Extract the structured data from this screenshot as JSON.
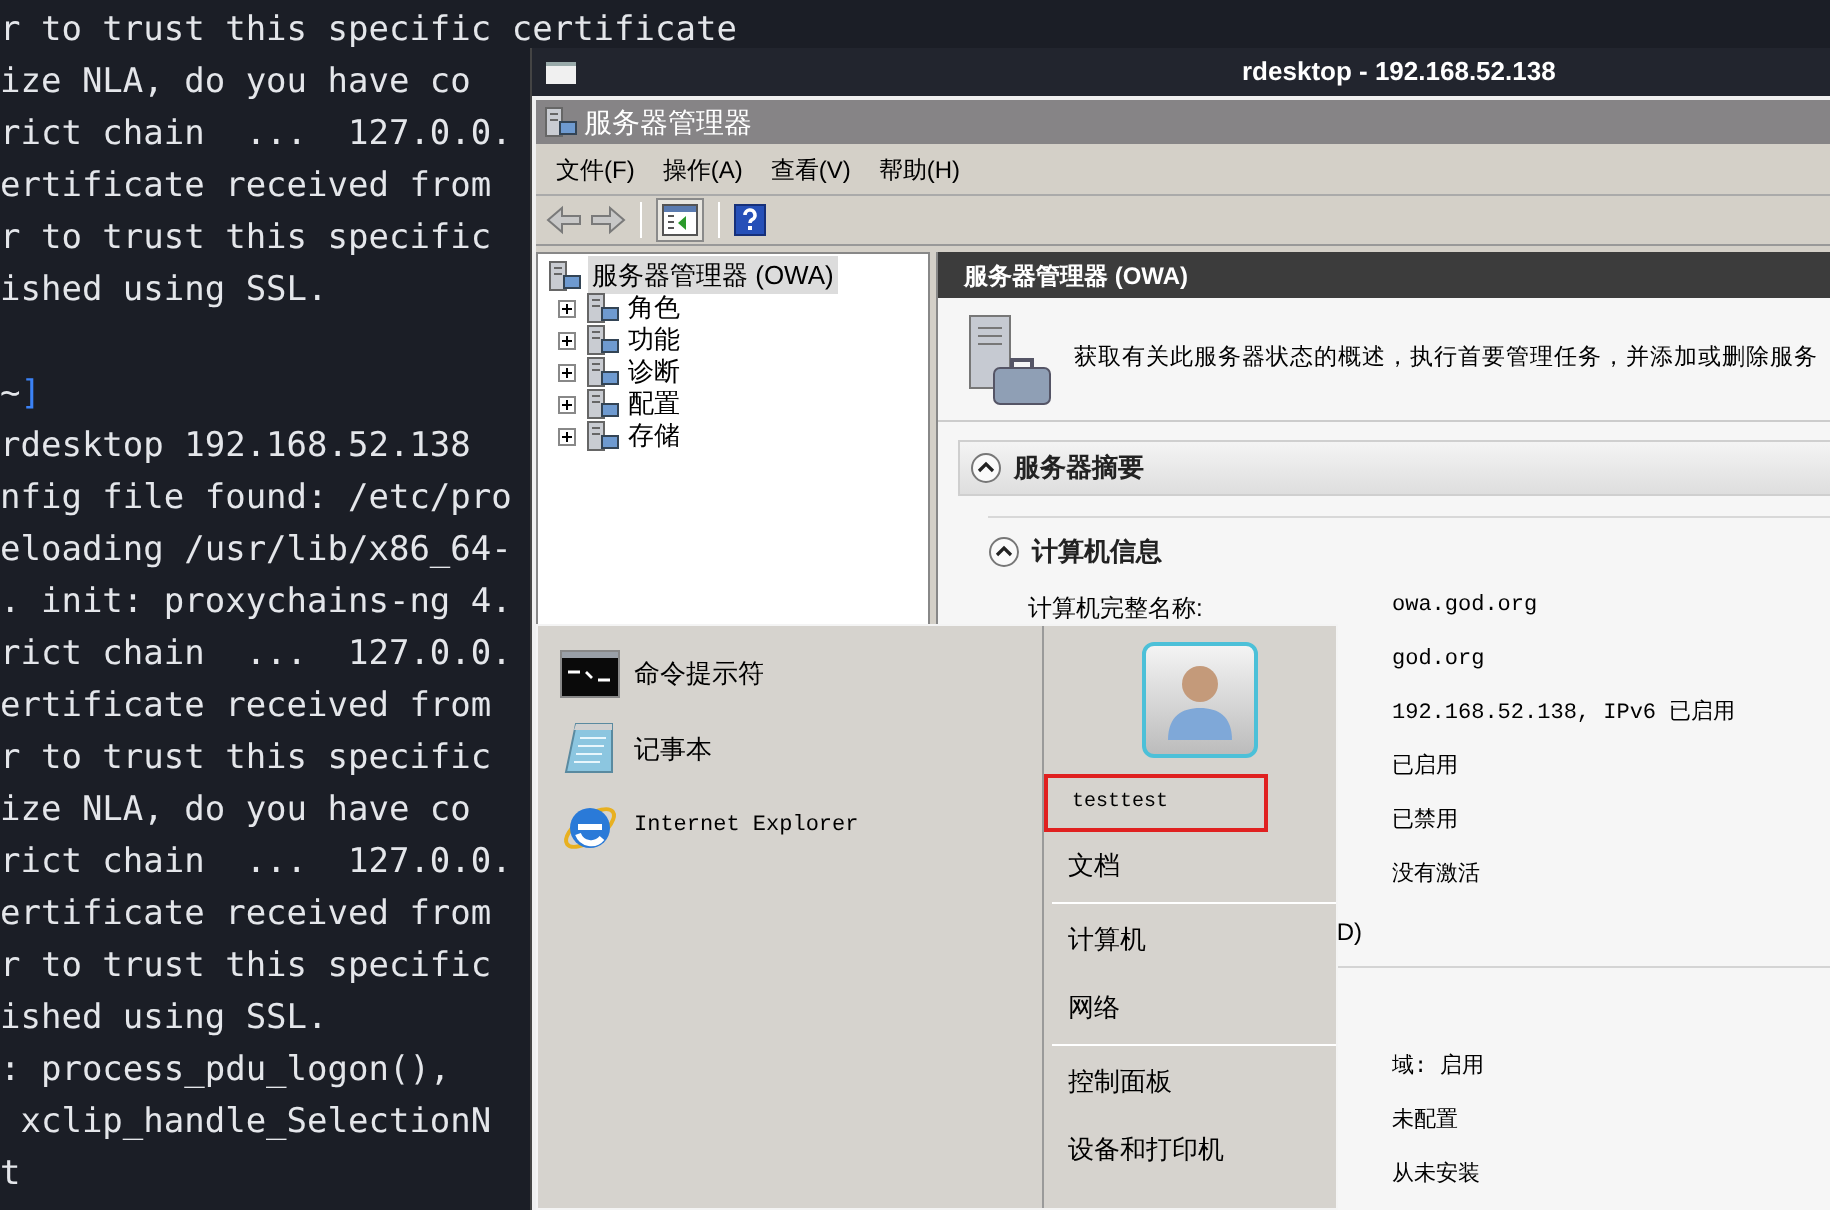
{
  "terminal": {
    "lines": [
      {
        "kind": "output",
        "text": "r to trust this specific certificate"
      },
      {
        "kind": "output",
        "text": "ize NLA, do you have co"
      },
      {
        "kind": "output",
        "text": "rict chain  ...  127.0.0."
      },
      {
        "kind": "output",
        "text": "ertificate received from"
      },
      {
        "kind": "output",
        "text": "r to trust this specific"
      },
      {
        "kind": "output",
        "text": "ished using SSL."
      },
      {
        "kind": "prompt",
        "dir": "~",
        "bracket": "]",
        "blank_before": true
      },
      {
        "kind": "output",
        "text": "rdesktop 192.168.52.138"
      },
      {
        "kind": "output",
        "text": "nfig file found: /etc/pro"
      },
      {
        "kind": "output",
        "text": "eloading /usr/lib/x86_64-"
      },
      {
        "kind": "output",
        "text": ". init: proxychains-ng 4."
      },
      {
        "kind": "output",
        "text": "rict chain  ...  127.0.0."
      },
      {
        "kind": "output",
        "text": "ertificate received from"
      },
      {
        "kind": "output",
        "text": "r to trust this specific"
      },
      {
        "kind": "output",
        "text": "ize NLA, do you have co"
      },
      {
        "kind": "output",
        "text": "rict chain  ...  127.0.0."
      },
      {
        "kind": "output",
        "text": "ertificate received from"
      },
      {
        "kind": "output",
        "text": "r to trust this specific"
      },
      {
        "kind": "output",
        "text": "ished using SSL."
      },
      {
        "kind": "output",
        "text": ": process_pdu_logon(),"
      },
      {
        "kind": "output",
        "text": " xclip_handle_SelectionN"
      },
      {
        "kind": "output",
        "text": "t"
      }
    ]
  },
  "window": {
    "title": "rdesktop - 192.168.52.138"
  },
  "server_manager": {
    "title": "服务器管理器",
    "menu": [
      "文件(F)",
      "操作(A)",
      "查看(V)",
      "帮助(H)"
    ],
    "toolbar": [
      {
        "kind": "back"
      },
      {
        "kind": "forward"
      },
      {
        "kind": "separator"
      },
      {
        "kind": "toggle",
        "pressed": true
      },
      {
        "kind": "separator"
      },
      {
        "kind": "help"
      }
    ],
    "tree": [
      {
        "label": "服务器管理器 (OWA)",
        "selected": true,
        "children": [
          {
            "label": "角色",
            "selected": false,
            "expanded": false
          },
          {
            "label": "功能",
            "selected": false,
            "expanded": false
          },
          {
            "label": "诊断",
            "selected": false,
            "expanded": false
          },
          {
            "label": "配置",
            "selected": false,
            "expanded": false
          },
          {
            "label": "存储",
            "selected": false,
            "expanded": false
          }
        ]
      }
    ],
    "pane": {
      "header": "服务器管理器 (OWA)",
      "description": "获取有关此服务器状态的概述，执行首要管理任务，并添加或删除服务",
      "section": {
        "title": "服务器摘要",
        "expanded": true,
        "subsection": {
          "title": "计算机信息",
          "expanded": true
        },
        "row_groups": [
          {
            "rows": [
              {
                "label": "计算机完整名称:",
                "value": "owa.god.org"
              },
              {
                "value": "god.org"
              },
              {
                "value": "192.168.52.138, IPv6 已启用"
              },
              {
                "value": "已启用"
              },
              {
                "value": "已禁用"
              },
              {
                "value": "没有激活"
              },
              {
                "label_tail": "D)"
              }
            ]
          },
          {
            "rows": [
              {
                "value": "域: 启用"
              },
              {
                "value": "未配置"
              },
              {
                "value": "从未安装"
              }
            ]
          }
        ]
      }
    }
  },
  "start_menu": {
    "programs": [
      {
        "kind": "console",
        "label": "命令提示符"
      },
      {
        "kind": "notepad",
        "label": "记事本"
      },
      {
        "kind": "browser",
        "label": "Internet Explorer"
      }
    ],
    "places": [
      {
        "kind": "user",
        "label": "testtest",
        "highlighted": true
      },
      {
        "kind": "link",
        "label": "文档"
      },
      {
        "kind": "divider"
      },
      {
        "kind": "link",
        "label": "计算机"
      },
      {
        "kind": "link",
        "label": "网络"
      },
      {
        "kind": "divider"
      },
      {
        "kind": "link",
        "label": "控制面板"
      },
      {
        "kind": "link",
        "label": "设备和打印机"
      }
    ]
  }
}
